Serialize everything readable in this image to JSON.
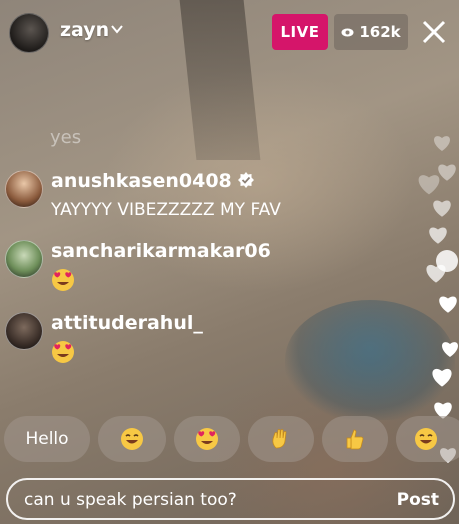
{
  "header": {
    "username": "zayn",
    "live_label": "LIVE",
    "viewer_count": "162k"
  },
  "comments": {
    "faded_text": "yes",
    "items": [
      {
        "user": "anushkasen0408",
        "verified": true,
        "text": "YAYYYY VIBEZZZZZ MY FAV"
      },
      {
        "user": "sancharikarmakar06",
        "verified": false,
        "text": ""
      },
      {
        "user": "attituderahul_",
        "verified": false,
        "text": ""
      }
    ]
  },
  "quick_reactions": {
    "hello_label": "Hello"
  },
  "composer": {
    "value": "can u speak persian too?",
    "post_label": "Post"
  },
  "colors": {
    "live": "#d5156a",
    "heart": "#ffffff"
  }
}
